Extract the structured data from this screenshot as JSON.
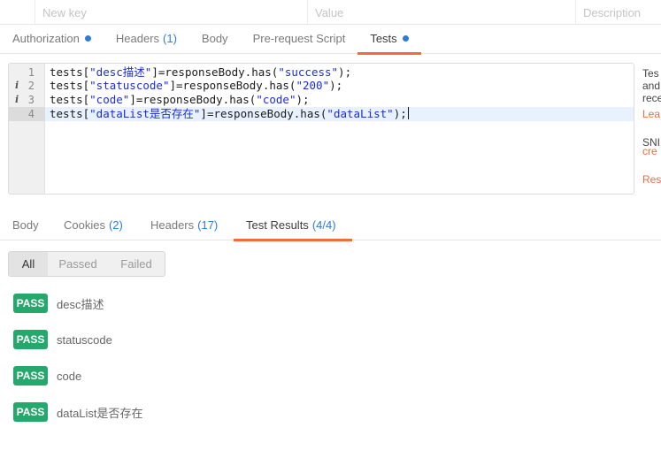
{
  "params": {
    "key_placeholder": "New key",
    "value_placeholder": "Value",
    "description_placeholder": "Description"
  },
  "request_tabs": [
    {
      "label": "Authorization",
      "count": "",
      "dot": true,
      "active": false
    },
    {
      "label": "Headers",
      "count": "(1)",
      "dot": false,
      "active": false
    },
    {
      "label": "Body",
      "count": "",
      "dot": false,
      "active": false
    },
    {
      "label": "Pre-request Script",
      "count": "",
      "dot": false,
      "active": false
    },
    {
      "label": "Tests",
      "count": "",
      "dot": true,
      "active": true
    }
  ],
  "editor": {
    "lines": [
      {
        "number": "1",
        "info": "",
        "parts": [
          [
            "p",
            "tests["
          ],
          [
            "s",
            "\"desc描述\""
          ],
          [
            "p",
            "]=responseBody.has("
          ],
          [
            "s",
            "\"success\""
          ],
          [
            "p",
            ");"
          ]
        ]
      },
      {
        "number": "2",
        "info": "i",
        "parts": [
          [
            "p",
            "tests["
          ],
          [
            "s",
            "\"statuscode\""
          ],
          [
            "p",
            "]=responseBody.has("
          ],
          [
            "s",
            "\"200\""
          ],
          [
            "p",
            ");"
          ]
        ]
      },
      {
        "number": "3",
        "info": "i",
        "parts": [
          [
            "p",
            "tests["
          ],
          [
            "s",
            "\"code\""
          ],
          [
            "p",
            "]=responseBody.has("
          ],
          [
            "s",
            "\"code\""
          ],
          [
            "p",
            ");"
          ]
        ]
      },
      {
        "number": "4",
        "info": "",
        "parts": [
          [
            "p",
            "tests["
          ],
          [
            "s",
            "\"dataList是否存在\""
          ],
          [
            "p",
            "]=responseBody.has("
          ],
          [
            "s",
            "\"dataList\""
          ],
          [
            "p",
            ");"
          ]
        ]
      }
    ],
    "active_line": 4
  },
  "side_panel": {
    "line1": "Tes",
    "line2": "and",
    "line3": "rece",
    "link1": "Lea",
    "heading": "SNI",
    "link2": "cre",
    "link3": "Res"
  },
  "response_tabs": [
    {
      "label": "Body",
      "count": "",
      "active": false
    },
    {
      "label": "Cookies",
      "count": "(2)",
      "active": false
    },
    {
      "label": "Headers",
      "count": "(17)",
      "active": false
    },
    {
      "label": "Test Results",
      "count": "(4/4)",
      "active": true
    }
  ],
  "filter": {
    "options": [
      "All",
      "Passed",
      "Failed"
    ],
    "selected": "All"
  },
  "results": [
    {
      "status": "PASS",
      "name": "desc描述"
    },
    {
      "status": "PASS",
      "name": "statuscode"
    },
    {
      "status": "PASS",
      "name": "code"
    },
    {
      "status": "PASS",
      "name": "dataList是否存在"
    }
  ],
  "colors": {
    "accent": "#f26b3a",
    "count_blue": "#2f7bd6",
    "pass_green": "#25a86b",
    "string_blue": "#1c2fd0",
    "active_line": "#e8f2ff"
  }
}
